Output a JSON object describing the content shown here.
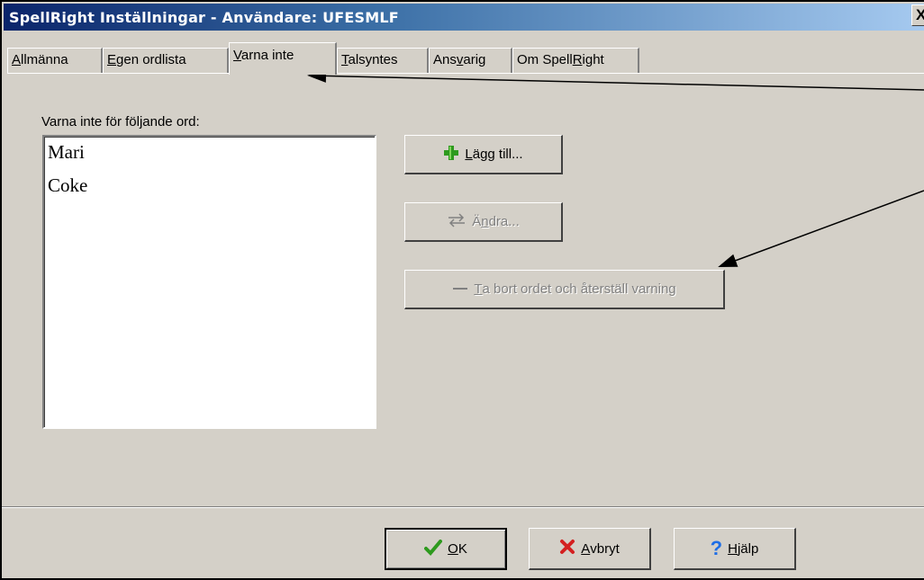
{
  "window": {
    "title": "SpellRight  Inställningar - Användare: UFESMLF",
    "close_glyph": "X"
  },
  "tabs": [
    {
      "pre": "",
      "ul": "A",
      "post": "llmänna"
    },
    {
      "pre": "",
      "ul": "E",
      "post": "gen ordlista"
    },
    {
      "pre": "",
      "ul": "V",
      "post": "arna inte"
    },
    {
      "pre": "",
      "ul": "T",
      "post": "alsyntes"
    },
    {
      "pre": "Ans",
      "ul": "v",
      "post": "arig"
    },
    {
      "pre": "Om Spell",
      "ul": "R",
      "post": "ight"
    }
  ],
  "panel": {
    "label": "Varna inte för följande ord:",
    "words": [
      "Mari",
      "Coke"
    ]
  },
  "buttons": {
    "add": {
      "icon": "plus-icon",
      "pre": "",
      "ul": "L",
      "post": "ägg till..."
    },
    "change": {
      "icon": "swap-icon",
      "pre": "Ä",
      "ul": "n",
      "post": "dra..."
    },
    "remove": {
      "icon": "dash-icon",
      "pre": "",
      "ul": "T",
      "post": "a bort ordet och återställ varning"
    }
  },
  "footer": {
    "ok": {
      "pre": "",
      "ul": "O",
      "post": "K"
    },
    "cancel": {
      "pre": "",
      "ul": "A",
      "post": "vbryt"
    },
    "help": {
      "pre": "",
      "ul": "H",
      "post": "jälp"
    }
  },
  "colors": {
    "title_start": "#0a246a",
    "title_end": "#a6caf0",
    "face": "#d4d0c8",
    "ok_check": "#2e9a1e",
    "cancel_x": "#d42020",
    "help_q": "#1e6ee6",
    "plus": "#2e9a1e"
  }
}
